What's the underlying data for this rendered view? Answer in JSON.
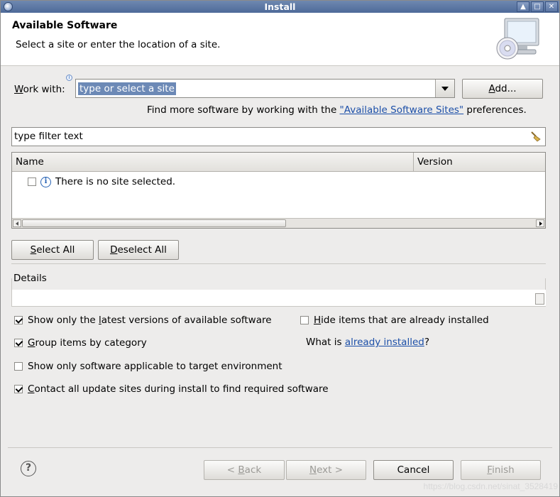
{
  "window": {
    "title": "Install"
  },
  "header": {
    "title": "Available Software",
    "subtitle": "Select a site or enter the location of a site."
  },
  "work_with": {
    "label_prefix": "",
    "label_mnemonic": "W",
    "label_rest": "ork with:",
    "value": "type or select a site",
    "add_button_mnemonic": "A",
    "add_button_rest": "dd..."
  },
  "find_more": {
    "prefix": "Find more software by working with the ",
    "link": "\"Available Software Sites\"",
    "suffix": " preferences."
  },
  "filter": {
    "value": "type filter text"
  },
  "table": {
    "columns": [
      "Name",
      "Version"
    ],
    "rows": [
      {
        "checked": false,
        "icon": "info-icon",
        "text": "There is no site selected."
      }
    ]
  },
  "select_all": {
    "mnemonic": "S",
    "rest": "elect All"
  },
  "deselect_all": {
    "mnemonic": "D",
    "rest": "eselect All"
  },
  "details": {
    "label": "Details",
    "value": ""
  },
  "options": {
    "latest": {
      "pre": "Show only the ",
      "mn": "l",
      "post": "atest versions of available software",
      "checked": true
    },
    "hide_installed": {
      "pre": "",
      "mn": "H",
      "post": "ide items that are already installed",
      "checked": false
    },
    "group": {
      "pre": "",
      "mn": "G",
      "post": "roup items by category",
      "checked": true
    },
    "what_is": {
      "pre": "What is ",
      "link": "already installed",
      "post": "?"
    },
    "target_env": {
      "pre": "Show only software applicable to target environment",
      "mn": "",
      "post": "",
      "checked": false
    },
    "contact": {
      "pre": "",
      "mn": "C",
      "post": "ontact all update sites during install to find required software",
      "checked": true
    }
  },
  "footer": {
    "back": {
      "pre": "< ",
      "mn": "B",
      "post": "ack"
    },
    "next": {
      "pre": "",
      "mn": "N",
      "post": "ext >"
    },
    "cancel": "Cancel",
    "finish": {
      "pre": "",
      "mn": "F",
      "post": "inish"
    }
  },
  "watermark": "https://blog.csdn.net/sinat_3528419"
}
